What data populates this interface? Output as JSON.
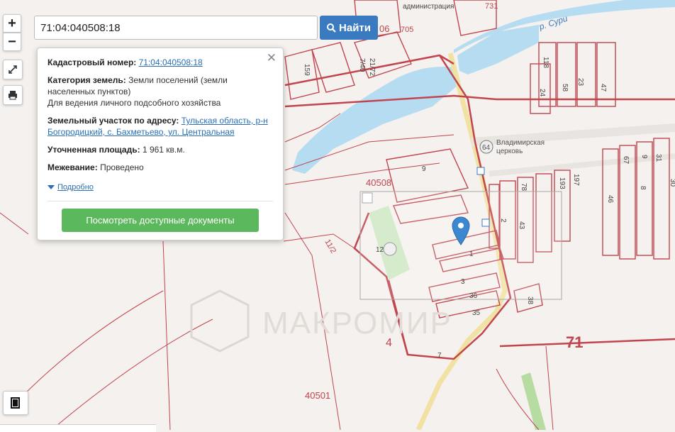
{
  "search": {
    "value": "71:04:040508:18",
    "button_label": "Найти"
  },
  "zoom": {
    "in_label": "+",
    "out_label": "−"
  },
  "popup": {
    "close_label": "✕",
    "cadastral_label": "Кадастровый номер:",
    "cadastral_value": "71:04:040508:18",
    "category_label": "Категория земель:",
    "category_value": "Земли поселений (земли населенных пунктов)",
    "usage": "Для ведения личного подсобного хозяйства",
    "address_label": "Земельный участок по адресу:",
    "address_value": "Тульская область, р-н Богородицкий, с. Бахметьево, ул. Центральная",
    "area_label": "Уточненная площадь:",
    "area_value": "1 961 кв.м.",
    "survey_label": "Межевание:",
    "survey_value": "Проведено",
    "more_label": "Подробно",
    "docs_button": "Посмотреть доступные документы"
  },
  "map_labels": {
    "river": "р. Сури",
    "church": "Владимирская церковь",
    "church_num": "64",
    "quarter_40508": "40508",
    "quarter_40501": "40501",
    "region_71": "71",
    "num_4": "4",
    "num_7": "7",
    "num_9": "9",
    "num_12": "12",
    "num_1": "1",
    "num_2": "2",
    "num_3": "3",
    "num_35": "35",
    "num_36": "36",
    "num_38": "38",
    "num_43": "43",
    "num_78": "78",
    "num_193": "193",
    "num_197": "197",
    "num_118": "118",
    "num_24": "24",
    "num_58": "58",
    "num_23": "23",
    "num_47": "47",
    "num_46": "46",
    "num_67": "67",
    "num_8": "8",
    "num_9b": "9",
    "num_31": "31",
    "num_30": "30",
    "num_11_2": "11/2",
    "num_705": "705",
    "num_06": "06",
    "num_159": "159",
    "num_740": "7/40",
    "num_2172": "21/72",
    "admin": "администрация",
    "num_731": "731",
    "watermark": "МАКРОМИР"
  },
  "colors": {
    "parcel": "#c0454e",
    "water": "#b6dcf2",
    "road": "#f1e2a4",
    "accent": "#3a7ac0",
    "green": "#5cb85c"
  }
}
